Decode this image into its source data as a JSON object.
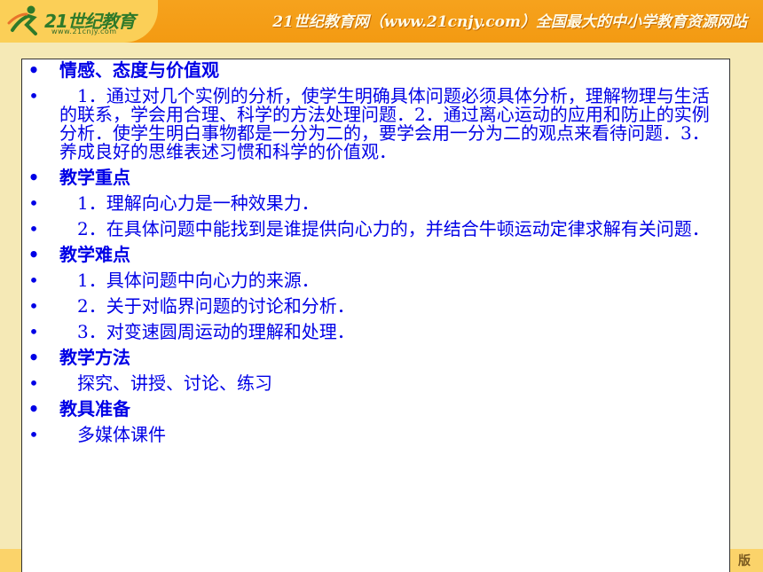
{
  "header": {
    "logo_text": "21世纪教育",
    "logo_url": "www.21cnjy.com",
    "slogan": "21世纪教育网（www.21cnjy.com）全国最大的中小学教育资源网站"
  },
  "footer": {
    "text": "版"
  },
  "items": [
    {
      "type": "heading",
      "text": "情感、态度与价值观"
    },
    {
      "type": "body",
      "text": "　1．通过对几个实例的分析，使学生明确具体问题必须具体分析，理解物理与生活的联系，学会用合理、科学的方法处理问题．2．通过离心运动的应用和防止的实例分析．使学生明白事物都是一分为二的，要学会用一分为二的观点来看待问题．3．养成良好的思维表述习惯和科学的价值观．"
    },
    {
      "type": "heading",
      "text": "教学重点"
    },
    {
      "type": "body",
      "text": "　1．理解向心力是一种效果力．"
    },
    {
      "type": "body",
      "text": "　2．在具体问题中能找到是谁提供向心力的，并结合牛顿运动定律求解有关问题．"
    },
    {
      "type": "heading",
      "text": "教学难点"
    },
    {
      "type": "body",
      "text": "　1．具体问题中向心力的来源．"
    },
    {
      "type": "body",
      "text": "　2．关于对临界问题的讨论和分析．"
    },
    {
      "type": "body",
      "text": "　3．对变速圆周运动的理解和处理．"
    },
    {
      "type": "heading",
      "text": "教学方法"
    },
    {
      "type": "body",
      "text": "　探究、讲授、讨论、练习"
    },
    {
      "type": "heading",
      "text": "教具准备"
    },
    {
      "type": "body",
      "text": "　多媒体课件"
    }
  ]
}
